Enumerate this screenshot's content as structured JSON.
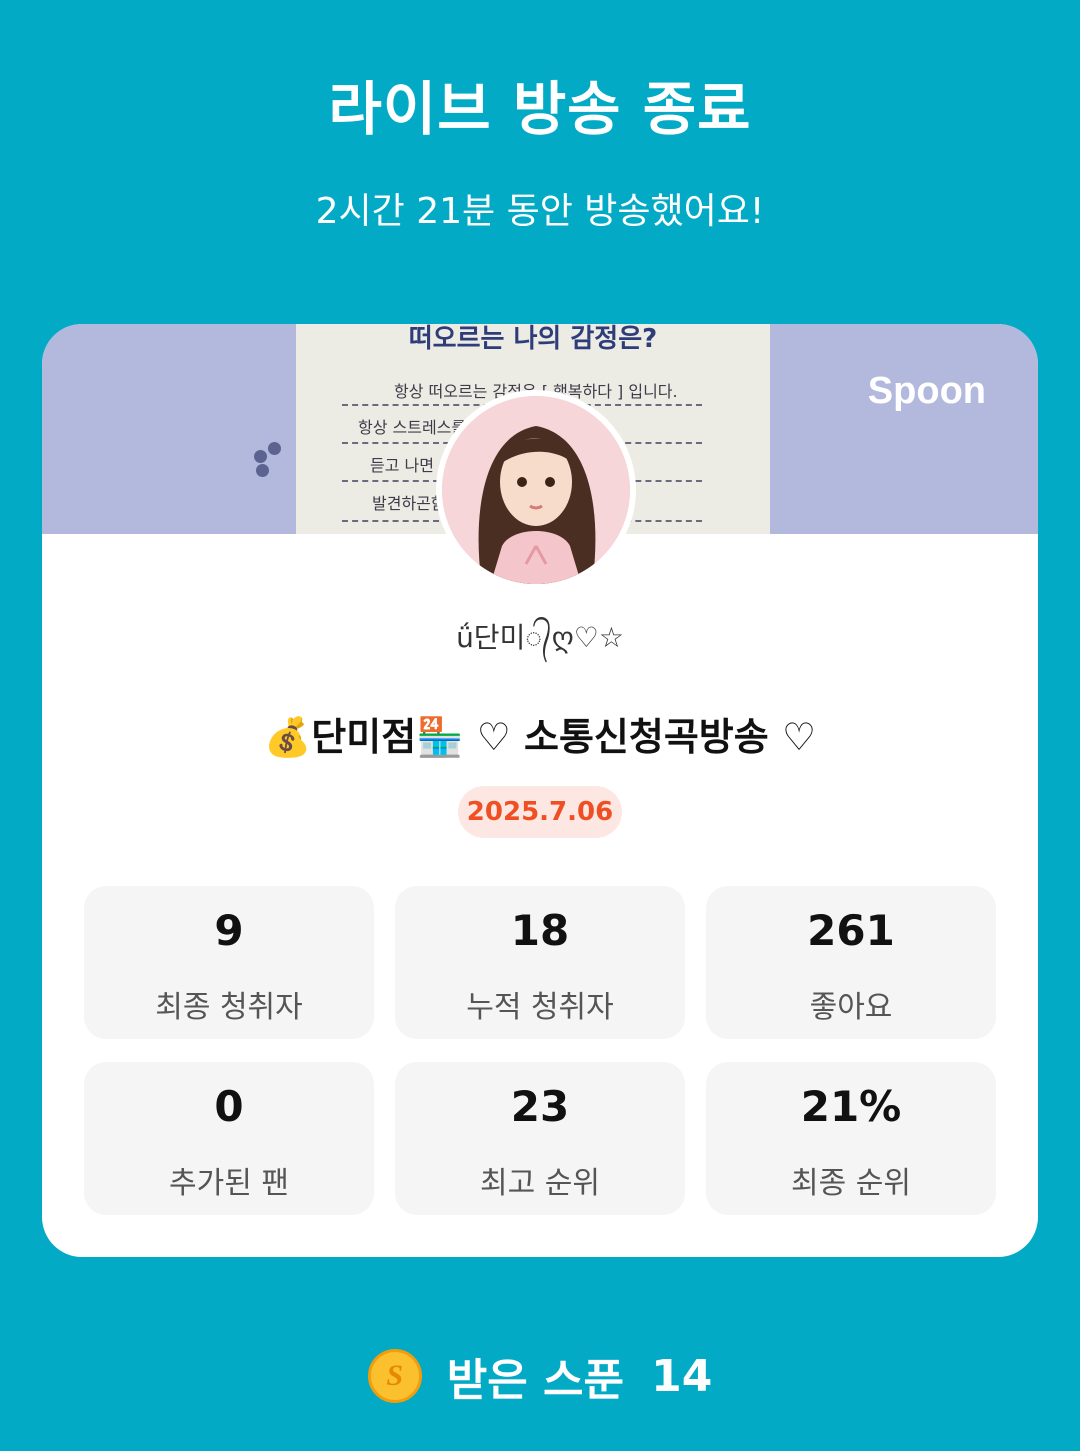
{
  "header": {
    "title": "라이브 방송 종료",
    "subtitle": "2시간 21분 동안 방송했어요!"
  },
  "card": {
    "banner": {
      "brand": "Spoon",
      "paper_heading": "떠오르는 나의 감정은?",
      "paper_lines": [
        "항상 떠오르는 감정은 [ 행복하다 ] 입니다.",
        "항상 스트레스를 ... 님의 방송을",
        "듣고 나면 ... 내모습을",
        "발견하곤함 ... 트레스는"
      ]
    },
    "nickname": "ǘ단미᭄ღ♡☆",
    "broadcast_title": "💰단미점🏪 ♡ 소통신청곡방송 ♡",
    "date": "2025.7.06",
    "stats": [
      {
        "value": "9",
        "label": "최종 청취자"
      },
      {
        "value": "18",
        "label": "누적 청취자"
      },
      {
        "value": "261",
        "label": "좋아요"
      },
      {
        "value": "0",
        "label": "추가된 팬"
      },
      {
        "value": "23",
        "label": "최고 순위"
      },
      {
        "value": "21%",
        "label": "최종 순위"
      }
    ]
  },
  "footer": {
    "coin_symbol": "S",
    "spoons_label": "받은 스푼",
    "spoons_count": "14"
  },
  "colors": {
    "background": "#02aac6",
    "card": "#ffffff",
    "banner": "#b3b8dd",
    "date_text": "#f04e23",
    "date_bg": "#fde7e2",
    "coin": "#fbc02d"
  }
}
